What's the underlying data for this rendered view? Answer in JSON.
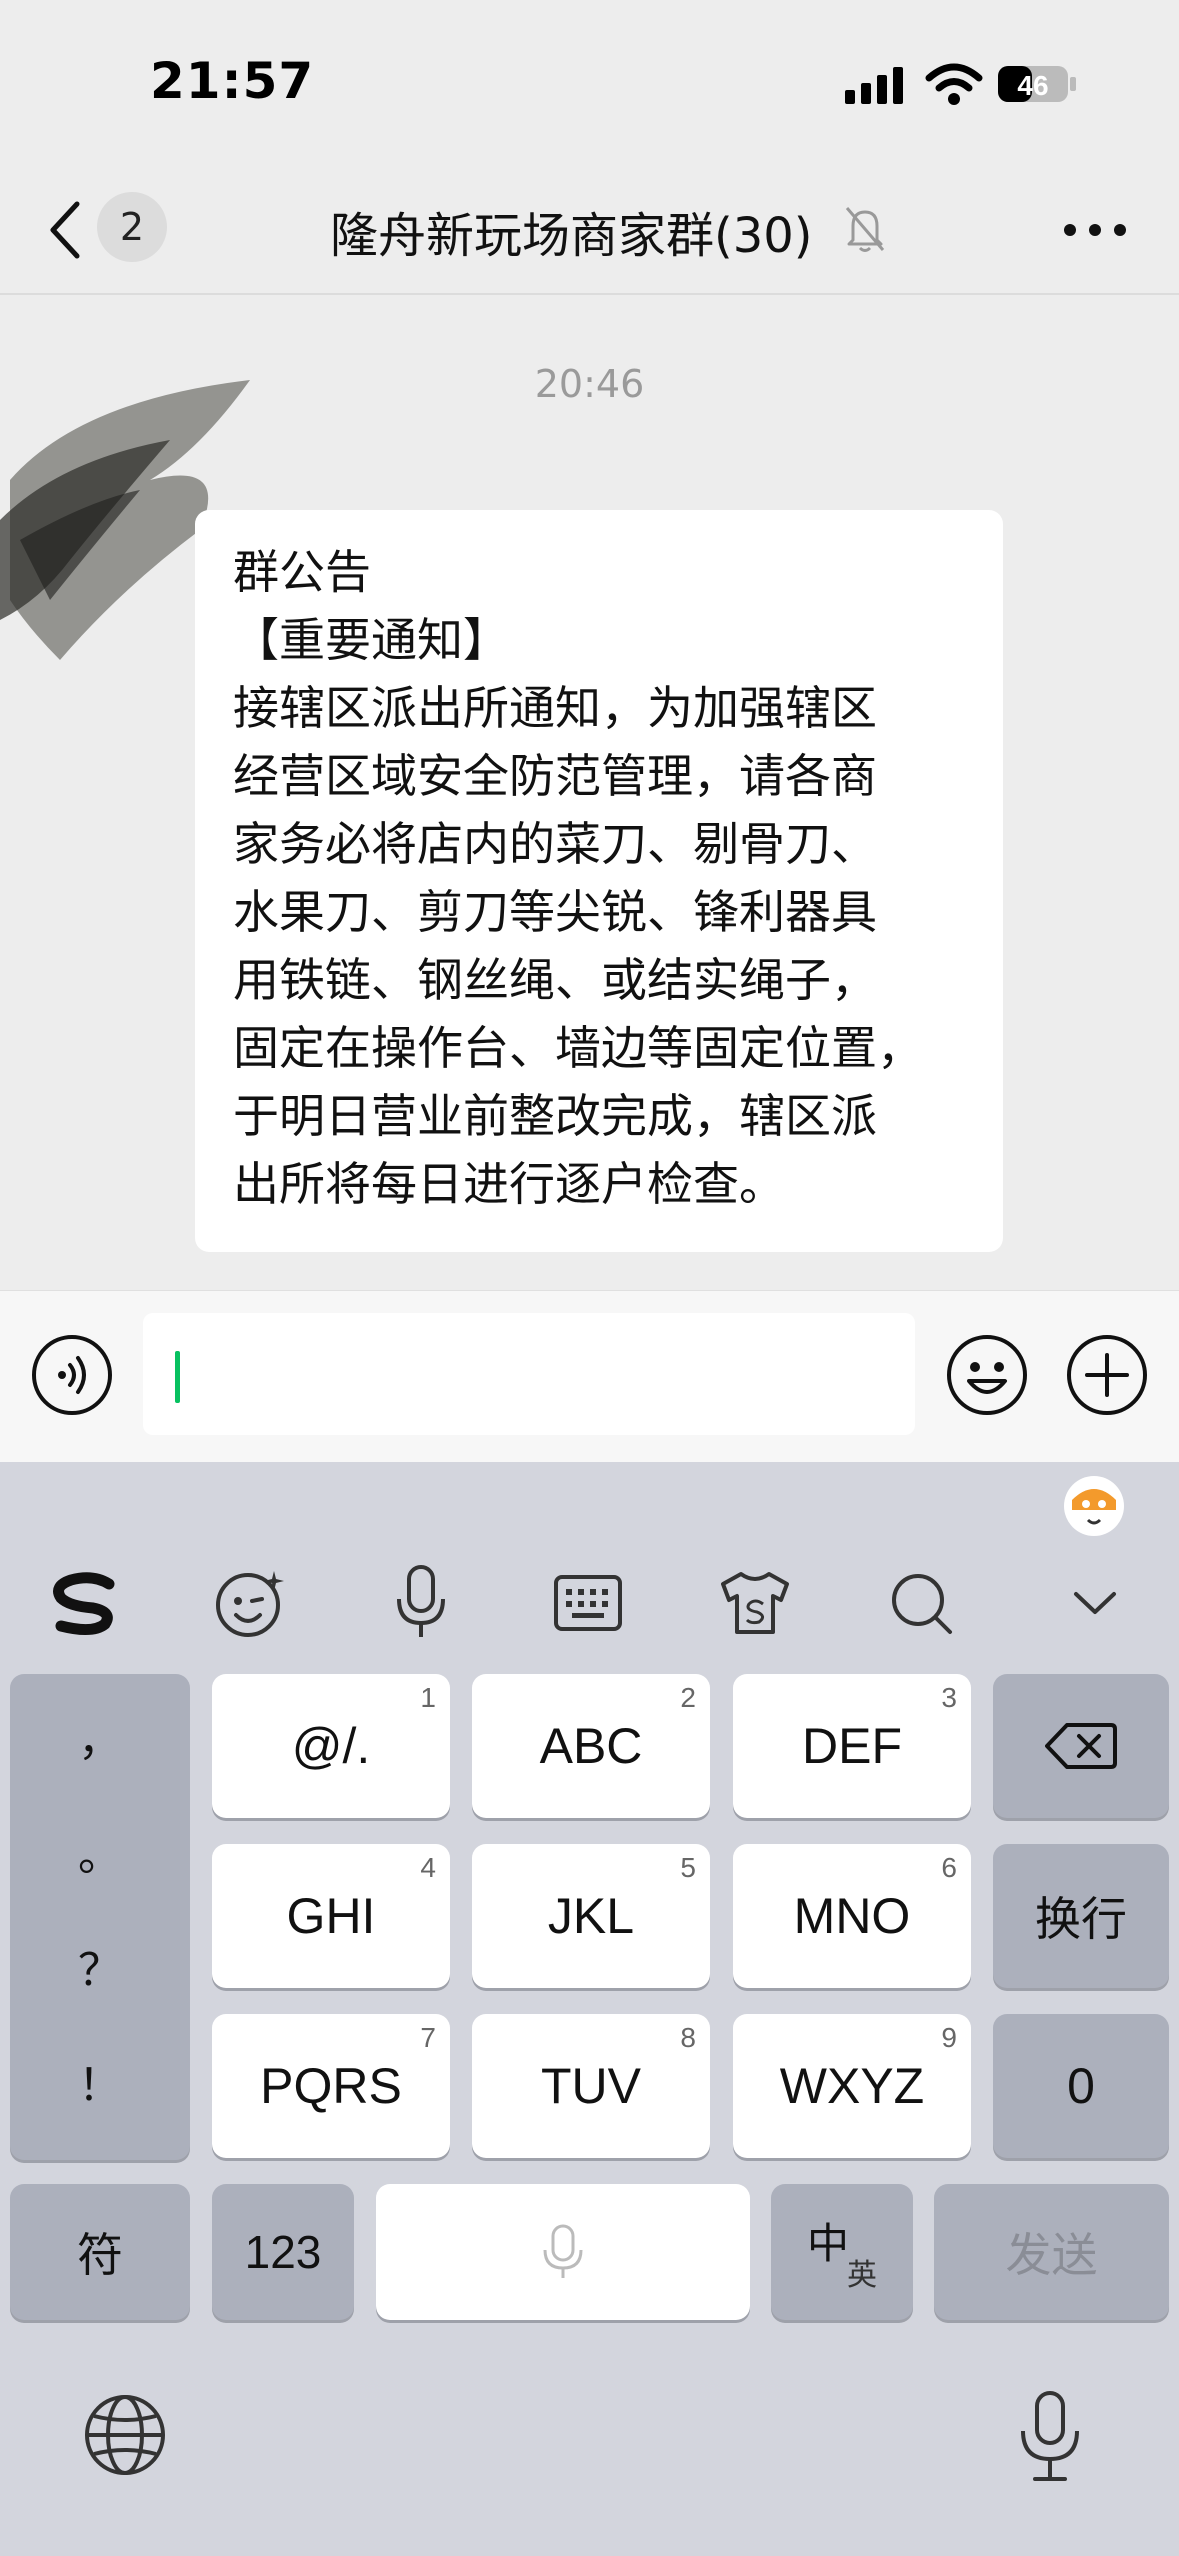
{
  "status_bar": {
    "time": "21:57",
    "battery": "46"
  },
  "nav": {
    "back_badge": "2",
    "title": "隆舟新玩场商家群(30)"
  },
  "chat": {
    "timestamp": "20:46",
    "message_lines": [
      "群公告",
      "【重要通知】",
      "接辖区派出所通知，为加强辖区",
      "经营区域安全防范管理，请各商",
      "家务必将店内的菜刀、剔骨刀、",
      "水果刀、剪刀等尖锐、锋利器具",
      "用铁链、钢丝绳、或结实绳子，",
      "固定在操作台、墙边等固定位置，",
      "于明日营业前整改完成，辖区派",
      "出所将每日进行逐户检查。"
    ]
  },
  "input_bar": {
    "text": ""
  },
  "keyboard": {
    "toolbar_icons": [
      "sogou-logo-icon",
      "emoji-face-icon",
      "voice-input-icon",
      "keyboard-layout-icon",
      "skin-theme-icon",
      "search-icon",
      "collapse-chevron-icon"
    ],
    "punctuation": [
      "，",
      "。",
      "？",
      "！"
    ],
    "keys_row1": [
      {
        "label": "@/.",
        "num": "1"
      },
      {
        "label": "ABC",
        "num": "2"
      },
      {
        "label": "DEF",
        "num": "3"
      }
    ],
    "keys_row2": [
      {
        "label": "GHI",
        "num": "4"
      },
      {
        "label": "JKL",
        "num": "5"
      },
      {
        "label": "MNO",
        "num": "6"
      }
    ],
    "keys_row3": [
      {
        "label": "PQRS",
        "num": "7"
      },
      {
        "label": "TUV",
        "num": "8"
      },
      {
        "label": "WXYZ",
        "num": "9"
      }
    ],
    "return_key": "换行",
    "zero_key": "0",
    "symbol_key": "符",
    "numbers_key": "123",
    "lang_key_main": "中",
    "lang_key_sub": "英",
    "send_key": "发送"
  },
  "colors": {
    "accent": "#07c160",
    "chat_bg": "#ededed",
    "keyboard_bg": "#d3d5dd"
  }
}
